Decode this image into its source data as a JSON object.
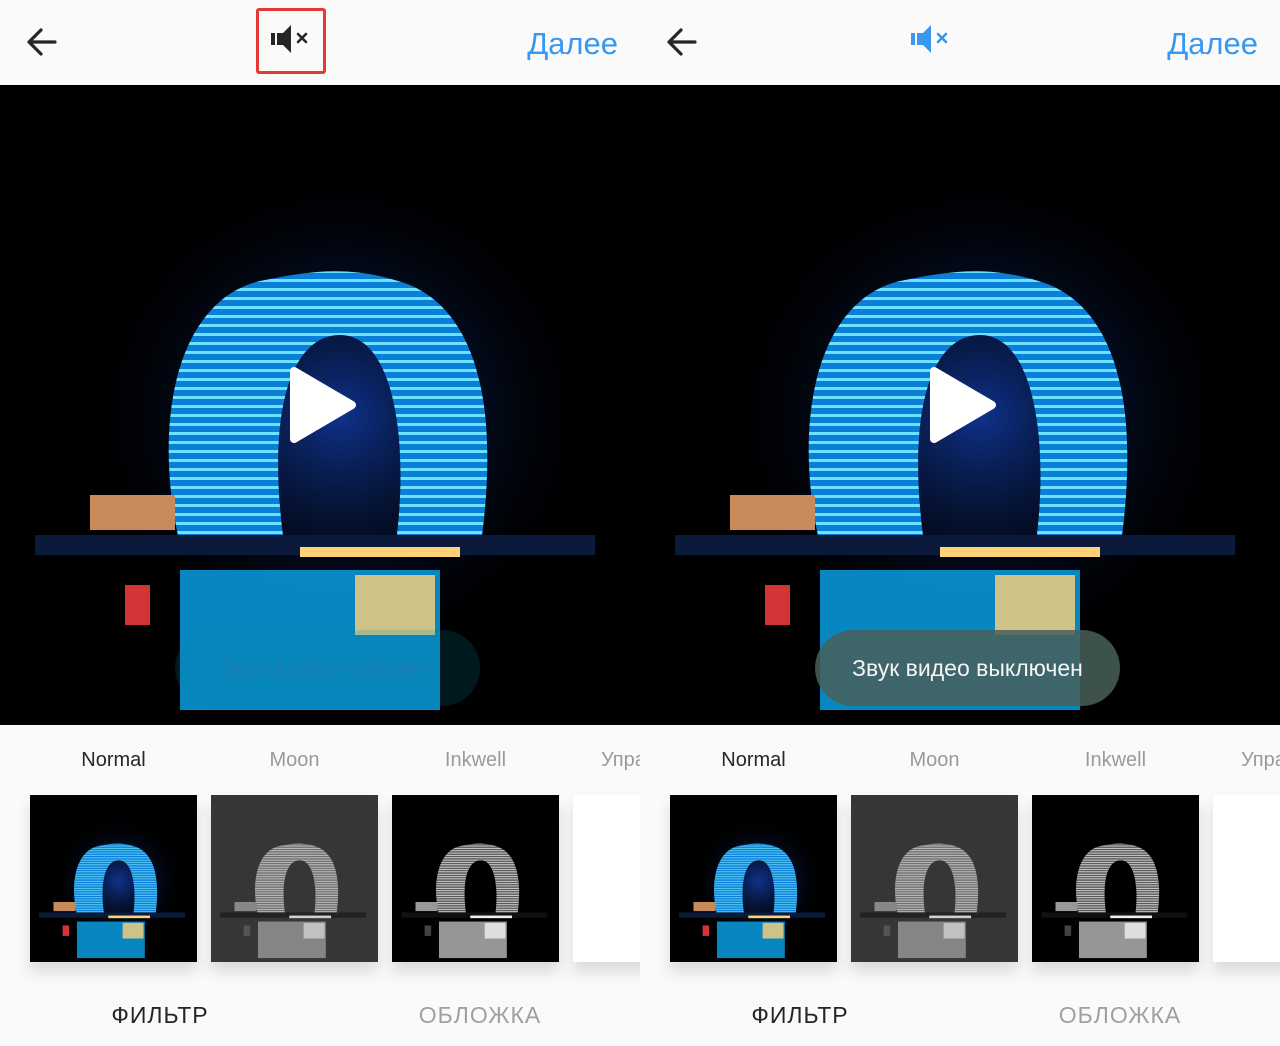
{
  "colors": {
    "accent": "#3897f0",
    "highlight": "#e53935",
    "tower": "#27b7f4"
  },
  "screens": [
    {
      "header": {
        "back_icon": "arrow-left-icon",
        "sound_icon": "speaker-muted-icon",
        "next_label": "Далее"
      },
      "video": {
        "play_icon": "play-icon",
        "toast": "Звук видео включен"
      },
      "filters": [
        {
          "label": "Normal"
        },
        {
          "label": "Moon"
        },
        {
          "label": "Inkwell"
        },
        {
          "label": "Упра"
        }
      ],
      "tabs": {
        "filter": "ФИЛЬТР",
        "cover": "ОБЛОЖКА"
      }
    },
    {
      "header": {
        "back_icon": "arrow-left-icon",
        "sound_icon": "speaker-muted-icon",
        "next_label": "Далее"
      },
      "video": {
        "play_icon": "play-icon",
        "toast": "Звук видео выключен"
      },
      "filters": [
        {
          "label": "Normal"
        },
        {
          "label": "Moon"
        },
        {
          "label": "Inkwell"
        },
        {
          "label": "Упра"
        }
      ],
      "tabs": {
        "filter": "ФИЛЬТР",
        "cover": "ОБЛОЖКА"
      }
    }
  ]
}
